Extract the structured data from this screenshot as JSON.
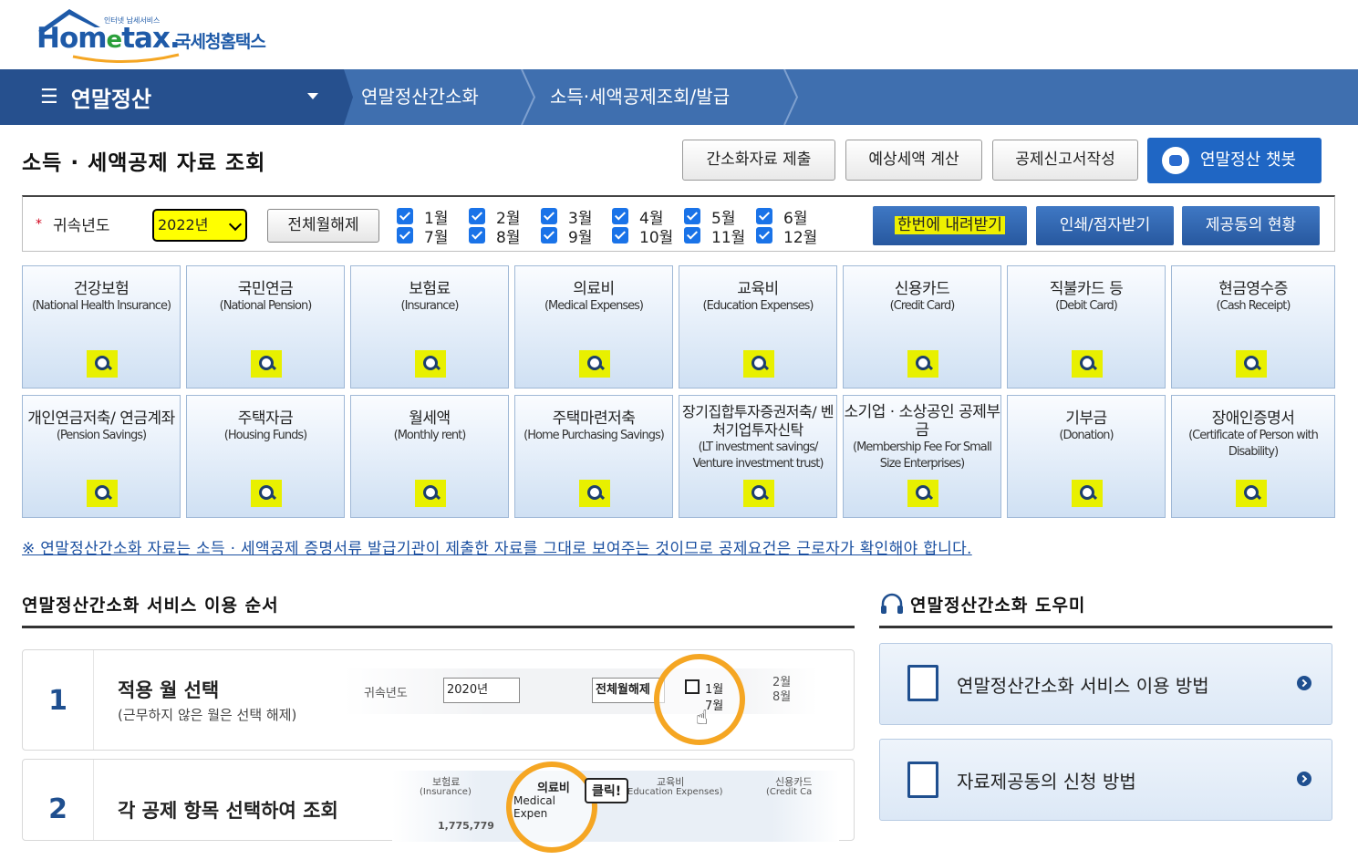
{
  "header": {
    "logo_small": "인터넷 납세서비스",
    "logo_home": "Hom",
    "logo_e": "e",
    "logo_tax": "tax.",
    "logo_kr": "국세청홈택스"
  },
  "nav": {
    "menu_label": "연말정산",
    "crumbs": [
      "연말정산간소화",
      "소득·세액공제조회/발급"
    ]
  },
  "page": {
    "title": "소득 · 세액공제 자료 조회",
    "buttons": [
      "간소화자료 제출",
      "예상세액 계산",
      "공제신고서작성"
    ],
    "chatbot_label": "연말정산 챗봇"
  },
  "filter": {
    "required_mark": "*",
    "year_label": "귀속년도",
    "year_value": "2022년",
    "all_toggle_label": "전체월해제",
    "months": [
      "1월",
      "2월",
      "3월",
      "4월",
      "5월",
      "6월",
      "7월",
      "8월",
      "9월",
      "10월",
      "11월",
      "12월"
    ],
    "download_all_label": "한번에 내려받기",
    "print_label": "인쇄/점자받기",
    "consent_label": "제공동의 현황"
  },
  "tiles": [
    {
      "title": "건강보험",
      "sub": "(National Health Insurance)"
    },
    {
      "title": "국민연금",
      "sub": "(National Pension)"
    },
    {
      "title": "보험료",
      "sub": "(Insurance)"
    },
    {
      "title": "의료비",
      "sub": "(Medical Expenses)"
    },
    {
      "title": "교육비",
      "sub": "(Education Expenses)"
    },
    {
      "title": "신용카드",
      "sub": "(Credit Card)"
    },
    {
      "title": "직불카드 등",
      "sub": "(Debit Card)"
    },
    {
      "title": "현금영수증",
      "sub": "(Cash Receipt)"
    },
    {
      "title": "개인연금저축/ 연금계좌",
      "sub": "(Pension Savings)"
    },
    {
      "title": "주택자금",
      "sub": "(Housing Funds)"
    },
    {
      "title": "월세액",
      "sub": "(Monthly rent)"
    },
    {
      "title": "주택마련저축",
      "sub": "(Home Purchasing Savings)"
    },
    {
      "title": "장기집합투자증권저축/ 벤처기업투자신탁",
      "sub": "(LT investment savings/ Venture investment trust)"
    },
    {
      "title": "소기업 · 소상공인 공제부금",
      "sub": "(Membership Fee For Small Size Enterprises)"
    },
    {
      "title": "기부금",
      "sub": "(Donation)"
    },
    {
      "title": "장애인증명서",
      "sub": "(Certificate of Person with Disability)"
    }
  ],
  "notice": "※ 연말정산간소화 자료는 소득 · 세액공제 증명서류 발급기관이 제출한 자료를 그대로 보여주는 것이므로 공제요건은 근로자가 확인해야 합니다.",
  "order_section": {
    "title": "연말정산간소화 서비스 이용 순서",
    "steps": [
      {
        "num": "1",
        "title": "적용 월 선택",
        "sub": "(근무하지 않은 월은 선택 해제)",
        "demo_year_label": "귀속년도",
        "demo_year": "2020년",
        "demo_all": "전체월해제",
        "demo_m1": "1월",
        "demo_m7": "7월",
        "demo_m2": "2월",
        "demo_m8": "8월"
      },
      {
        "num": "2",
        "title": "각 공제 항목 선택하여 조회",
        "demo_tile1": "보험료",
        "demo_tile1_sub": "(Insurance)",
        "demo_tile1_amount": "1,775,779",
        "demo_tile2": "의료비",
        "demo_tile2_sub": "Medical Expen",
        "demo_click": "클릭!",
        "demo_tile3": "교육비",
        "demo_tile3_sub": "Education Expenses)",
        "demo_tile4": "신용카드",
        "demo_tile4_sub": "(Credit Ca"
      }
    ]
  },
  "helper_section": {
    "title": "연말정산간소화 도우미",
    "cards": [
      "연말정산간소화 서비스 이용 방법",
      "자료제공동의 신청 방법"
    ]
  },
  "colors": {
    "nav_bg": "#3f6faf",
    "nav_menu_bg": "#26508e",
    "highlight": "#eef000",
    "chatbot_bg": "#1f66c4",
    "accent_orange": "#f5a623"
  }
}
